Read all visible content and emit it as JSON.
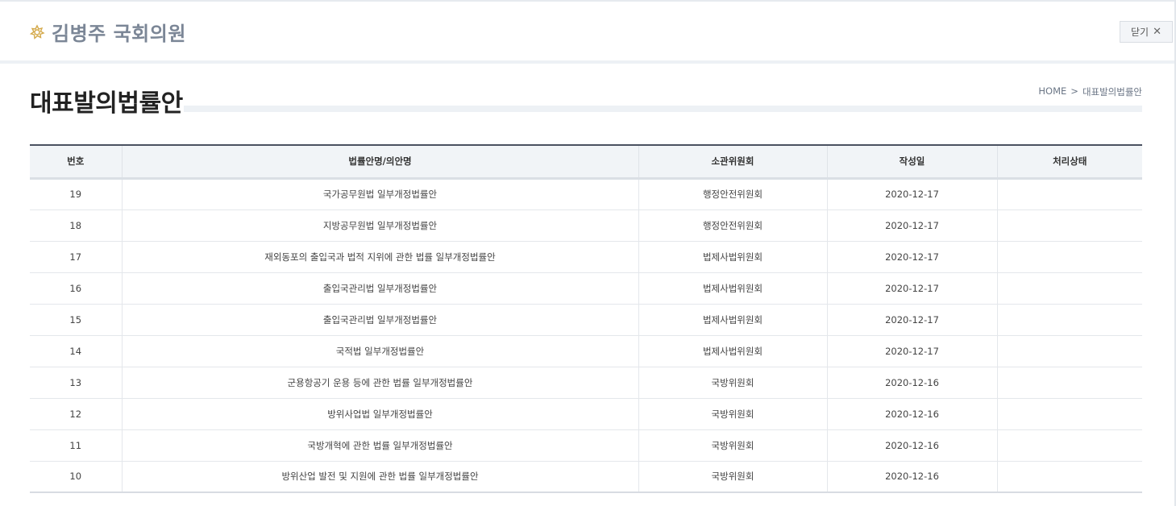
{
  "header": {
    "emblem_icon": "national-assembly-emblem-icon",
    "member_name": "김병주 국회의원",
    "close_label": "닫기",
    "close_icon": "close-icon"
  },
  "page": {
    "title": "대표발의법률안"
  },
  "breadcrumb": {
    "home": "HOME",
    "separator": ">",
    "current": "대표발의법률안"
  },
  "table": {
    "columns": [
      "번호",
      "법률안명/의안명",
      "소관위원회",
      "작성일",
      "처리상태"
    ],
    "rows": [
      {
        "no": "19",
        "name": "국가공무원법 일부개정법률안",
        "committee": "행정안전위원회",
        "date": "2020-12-17",
        "status": ""
      },
      {
        "no": "18",
        "name": "지방공무원법 일부개정법률안",
        "committee": "행정안전위원회",
        "date": "2020-12-17",
        "status": ""
      },
      {
        "no": "17",
        "name": "재외동포의 출입국과 법적 지위에 관한 법률 일부개정법률안",
        "committee": "법제사법위원회",
        "date": "2020-12-17",
        "status": ""
      },
      {
        "no": "16",
        "name": "출입국관리법 일부개정법률안",
        "committee": "법제사법위원회",
        "date": "2020-12-17",
        "status": ""
      },
      {
        "no": "15",
        "name": "출입국관리법 일부개정법률안",
        "committee": "법제사법위원회",
        "date": "2020-12-17",
        "status": ""
      },
      {
        "no": "14",
        "name": "국적법 일부개정법률안",
        "committee": "법제사법위원회",
        "date": "2020-12-17",
        "status": ""
      },
      {
        "no": "13",
        "name": "군용항공기 운용 등에 관한 법률 일부개정법률안",
        "committee": "국방위원회",
        "date": "2020-12-16",
        "status": ""
      },
      {
        "no": "12",
        "name": "방위사업법 일부개정법률안",
        "committee": "국방위원회",
        "date": "2020-12-16",
        "status": ""
      },
      {
        "no": "11",
        "name": "국방개혁에 관한 법률 일부개정법률안",
        "committee": "국방위원회",
        "date": "2020-12-16",
        "status": ""
      },
      {
        "no": "10",
        "name": "방위산업 발전 및 지원에 관한 법률 일부개정법률안",
        "committee": "국방위원회",
        "date": "2020-12-16",
        "status": ""
      }
    ]
  },
  "colors": {
    "accent_header_border": "#4a5160",
    "brand_text": "#7b8696",
    "emblem_gold": "#d4a94a"
  }
}
